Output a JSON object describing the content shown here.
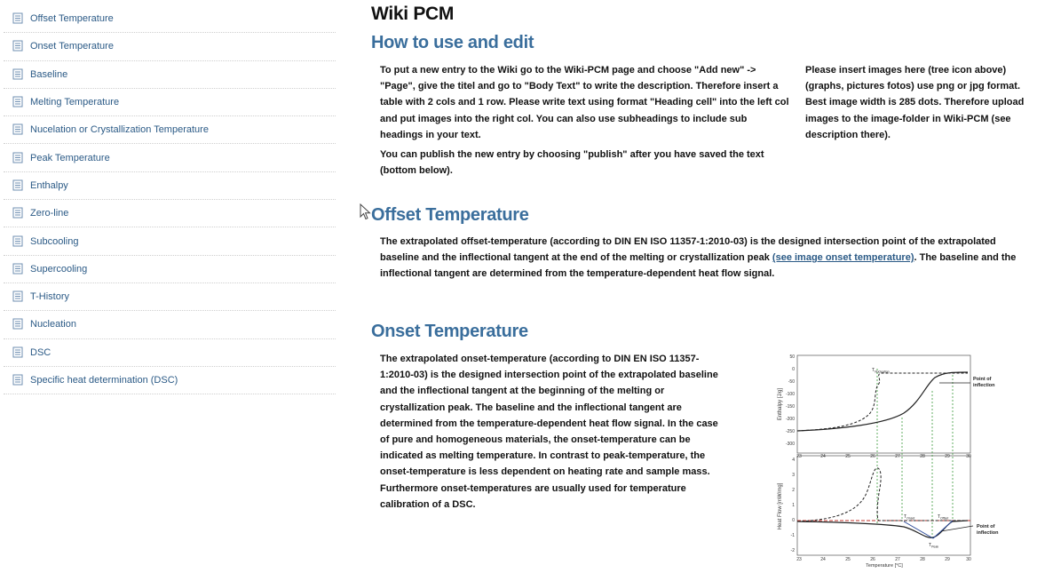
{
  "sidebar": {
    "items": [
      {
        "label": "Offset Temperature"
      },
      {
        "label": "Onset Temperature"
      },
      {
        "label": "Baseline"
      },
      {
        "label": "Melting Temperature"
      },
      {
        "label": "Nucelation or Crystallization Temperature"
      },
      {
        "label": "Peak Temperature"
      },
      {
        "label": "Enthalpy"
      },
      {
        "label": "Zero-line"
      },
      {
        "label": "Subcooling"
      },
      {
        "label": "Supercooling"
      },
      {
        "label": "T-History"
      },
      {
        "label": "Nucleation"
      },
      {
        "label": "DSC"
      },
      {
        "label": "Specific heat determination (DSC)"
      }
    ]
  },
  "main": {
    "title": "Wiki PCM",
    "how_to": {
      "heading": "How to use and edit",
      "para1": "To put a new entry to the Wiki go to the Wiki-PCM page and choose \"Add  new\" -> \"Page\", give the titel and go to \"Body Text\" to write the description. Therefore insert a table with 2 cols and 1 row.  Please write text using format \"Heading cell\" into the left col and put images into the right col. You can also use subheadings to include sub headings in your text.",
      "para2": "You can publish the new entry by choosing \"publish\" after you have saved the text (bottom below).",
      "side_note": "Please insert images here (tree icon above) (graphs, pictures fotos) use png or jpg format. Best image width is 285 dots. Therefore upload images to the image-folder in Wiki-PCM (see description there)."
    },
    "offset": {
      "heading": "Offset Temperature",
      "text_before": "The extrapolated offset-temperature (according to DIN EN ISO 11357-1:2010-03) is the designed intersection point of the extrapolated baseline and the inflectional tangent at the end of the melting or crystallization peak ",
      "link": "(see image onset temperature)",
      "text_after": ". The baseline and the inflectional tangent are determined from the temperature-dependent heat flow signal."
    },
    "onset": {
      "heading": "Onset Temperature",
      "text": "The extrapolated onset-temperature (according to DIN EN ISO 11357-1:2010-03) is the designed intersection point of the extrapolated baseline and the inflectional tangent at the beginning of the melting or crystallization peak. The baseline and the inflectional tangent are determined from the temperature-dependent heat flow signal. In the case of pure and homogeneous materials, the onset-temperature can be indicated as melting temperature. In contrast to peak-temperature, the onset-temperature is less dependent on heating rate and sample mass. Furthermore onset-temperatures are usually used for temperature calibration of a DSC."
    },
    "figure": {
      "top_ylabel": "Enthalpy [J/g]",
      "bottom_ylabel": "Heat Flow [mW/mg]",
      "xlabel": "Temperature [°C]",
      "top_yticks": [
        "50",
        "0",
        "-50",
        "-100",
        "-150",
        "-200",
        "-250",
        "-300"
      ],
      "bottom_yticks": [
        "4",
        "3",
        "2",
        "1",
        "0",
        "-1",
        "-2"
      ],
      "xticks": [
        "23",
        "24",
        "25",
        "26",
        "27",
        "28",
        "29",
        "30"
      ],
      "t_nucleation": "T",
      "t_nucleation_sub": "Nucleation",
      "t_onset": "T",
      "t_onset_sub": "Onset",
      "t_offset": "T",
      "t_offset_sub": "Offset",
      "t_peak": "T",
      "t_peak_sub": "Peak",
      "poi_top_1": "Point of",
      "poi_top_2": "inflection",
      "poi_bot_1": "Point of",
      "poi_bot_2": "inflection"
    }
  }
}
